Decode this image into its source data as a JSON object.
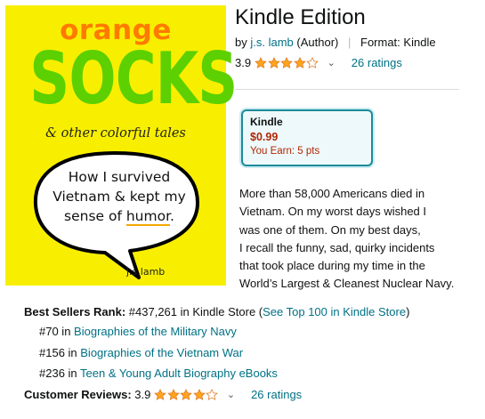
{
  "cover": {
    "line1": "orange",
    "line2": "SOCKS",
    "subtitle": "& other colorful tales",
    "bubble_line1": "How I survived",
    "bubble_line2": "Vietnam & kept my",
    "bubble_line3_pre": "sense of ",
    "bubble_line3_underlined": "humor",
    "bubble_line3_post": ".",
    "author": "j.s.lamb"
  },
  "product": {
    "title": "Kindle Edition",
    "by_label": "by",
    "author": "j.s. lamb",
    "author_role": "(Author)",
    "format_label": "Format:",
    "format_value": "Kindle",
    "rating": "3.9",
    "rating_stars": 3.9,
    "ratings_count": "26 ratings"
  },
  "price_box": {
    "format": "Kindle",
    "price": "$0.99",
    "earn": "You Earn: 5 pts"
  },
  "description": {
    "lines": [
      "More than 58,000 Americans died in",
      "Vietnam. On my worst days wished I",
      "was one of them. On my best days,",
      "I recall the funny, sad, quirky incidents",
      "that took place during my time in the",
      "World’s Largest & Cleanest Nuclear Navy."
    ]
  },
  "details": {
    "bsr_label": "Best Sellers Rank:",
    "bsr_value": "#437,261 in Kindle Store (",
    "bsr_link": "See Top 100 in Kindle Store",
    "bsr_close": ")",
    "ranks": [
      {
        "rank": "#70 in ",
        "category": "Biographies of the Military Navy"
      },
      {
        "rank": "#156 in ",
        "category": "Biographies of the Vietnam War"
      },
      {
        "rank": "#236 in ",
        "category": "Teen & Young Adult Biography eBooks"
      }
    ],
    "reviews_label": "Customer Reviews:",
    "reviews_rating": "3.9",
    "reviews_count": "26 ratings"
  },
  "colors": {
    "cover_bg": "#f8ef00",
    "orange": "#ff7a00",
    "green": "#5cd000",
    "link": "#007185",
    "price": "#b12704",
    "star": "#ffa41c"
  }
}
